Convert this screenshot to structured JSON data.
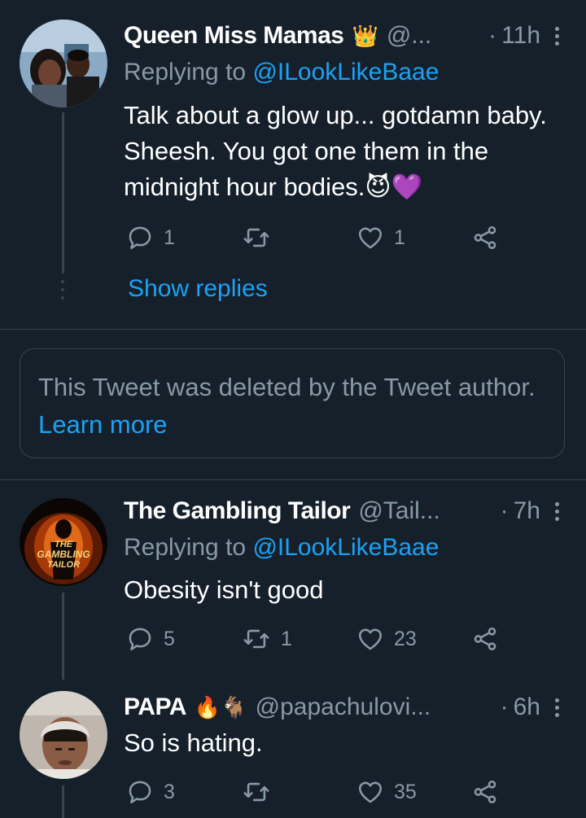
{
  "tweets": [
    {
      "name": "Queen Miss Mamas",
      "emoji": "👑",
      "handle": "@...",
      "dot": "·",
      "time": "11h",
      "replying_prefix": "Replying to",
      "replying_to": "@ILookLikeBaae",
      "text": "Talk about a glow up... gotdamn baby. Sheesh. You got one them in the midnight hour bodies.😈💜",
      "reply_count": "1",
      "retweet_count": "",
      "like_count": "1",
      "show_replies": "Show replies"
    },
    {
      "name": "The Gambling Tailor",
      "handle": "@Tail...",
      "dot": "·",
      "time": "7h",
      "replying_prefix": "Replying to",
      "replying_to": "@ILookLikeBaae",
      "text": "Obesity isn't good",
      "reply_count": "5",
      "retweet_count": "1",
      "like_count": "23",
      "avatar_text": "THE GAMBLING TAILOR"
    },
    {
      "name": "PAPA",
      "emoji": "🔥🐐",
      "handle": "@papachulovi...",
      "dot": "·",
      "time": "6h",
      "text": "So is hating.",
      "reply_count": "3",
      "retweet_count": "",
      "like_count": "35"
    }
  ],
  "deleted_notice": {
    "text": "This Tweet was deleted by the Tweet author.",
    "link": "Learn more"
  },
  "colors": {
    "background": "#15202b",
    "secondary_text": "#8899a6",
    "accent": "#1da1f2",
    "border": "#38444d"
  }
}
